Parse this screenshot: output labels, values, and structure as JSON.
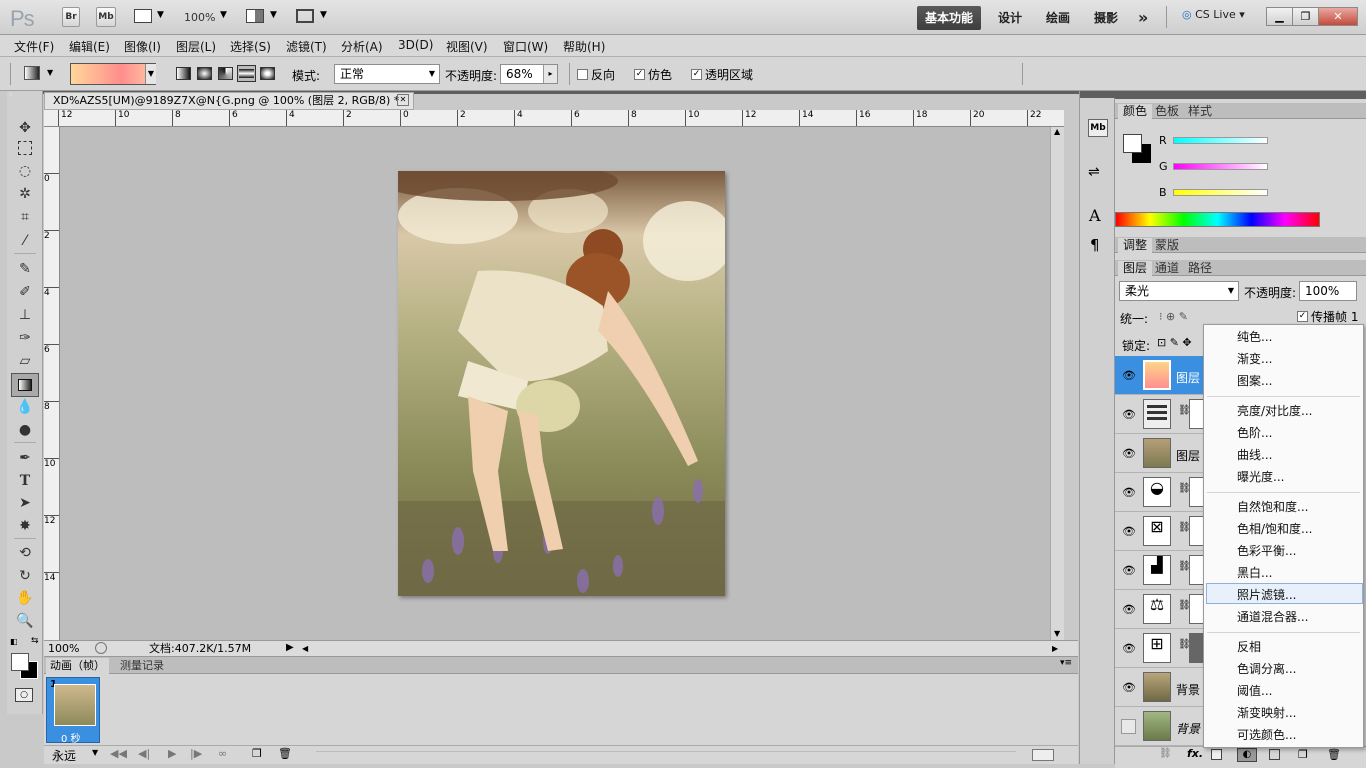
{
  "app": {
    "logo": "Ps",
    "br": "Br",
    "mb": "Mb",
    "zoom": "100%",
    "workspaces": [
      "基本功能",
      "设计",
      "绘画",
      "摄影"
    ],
    "more": "»",
    "cslive": "CS Live"
  },
  "menu": [
    "文件(F)",
    "编辑(E)",
    "图像(I)",
    "图层(L)",
    "选择(S)",
    "滤镜(T)",
    "分析(A)",
    "3D(D)",
    "视图(V)",
    "窗口(W)",
    "帮助(H)"
  ],
  "options": {
    "mode_label": "模式:",
    "mode_value": "正常",
    "opacity_label": "不透明度:",
    "opacity_value": "68%",
    "reverse": "反向",
    "dither": "仿色",
    "transparency": "透明区域"
  },
  "document": {
    "tab_title": "XD%AZS5[UM)@9189Z7X@N{G.png @ 100% (图层 2, RGB/8) *",
    "ruler_h": [
      "12",
      "10",
      "8",
      "6",
      "4",
      "2",
      "0",
      "2",
      "4",
      "6",
      "8",
      "10",
      "12",
      "14",
      "16",
      "18",
      "20",
      "22"
    ],
    "ruler_v": [
      "0",
      "2",
      "4",
      "6",
      "8",
      "10",
      "12",
      "14"
    ],
    "zoom": "100%",
    "docinfo": "文档:407.2K/1.57M"
  },
  "animation": {
    "tabs": [
      "动画（帧）",
      "测量记录"
    ],
    "frame_num": "1",
    "frame_time": "0 秒",
    "loop": "永远"
  },
  "color_panel": {
    "tabs": [
      "颜色",
      "色板",
      "样式"
    ],
    "r_label": "R",
    "g_label": "G",
    "b_label": "B",
    "r": "255",
    "g": "255",
    "b": "255"
  },
  "adjust_panel": {
    "tabs": [
      "调整",
      "蒙版"
    ]
  },
  "layers_panel": {
    "tabs": [
      "图层",
      "通道",
      "路径"
    ],
    "blend": "柔光",
    "opacity_label": "不透明度:",
    "opacity": "100%",
    "unify": "统一:",
    "propagate": "传播帧 1",
    "lock": "锁定:",
    "layers": [
      {
        "name": "图层"
      },
      {
        "name": ""
      },
      {
        "name": "图层"
      },
      {
        "name": ""
      },
      {
        "name": ""
      },
      {
        "name": ""
      },
      {
        "name": ""
      },
      {
        "name": ""
      },
      {
        "name": "背景"
      },
      {
        "name": "背景"
      }
    ]
  },
  "context_menu": {
    "items": [
      "纯色...",
      "渐变...",
      "图案...",
      "亮度/对比度...",
      "色阶...",
      "曲线...",
      "曝光度...",
      "自然饱和度...",
      "色相/饱和度...",
      "色彩平衡...",
      "黑白...",
      "照片滤镜...",
      "通道混合器...",
      "反相",
      "色调分离...",
      "阈值...",
      "渐变映射...",
      "可选颜色..."
    ],
    "highlighted": "照片滤镜..."
  }
}
